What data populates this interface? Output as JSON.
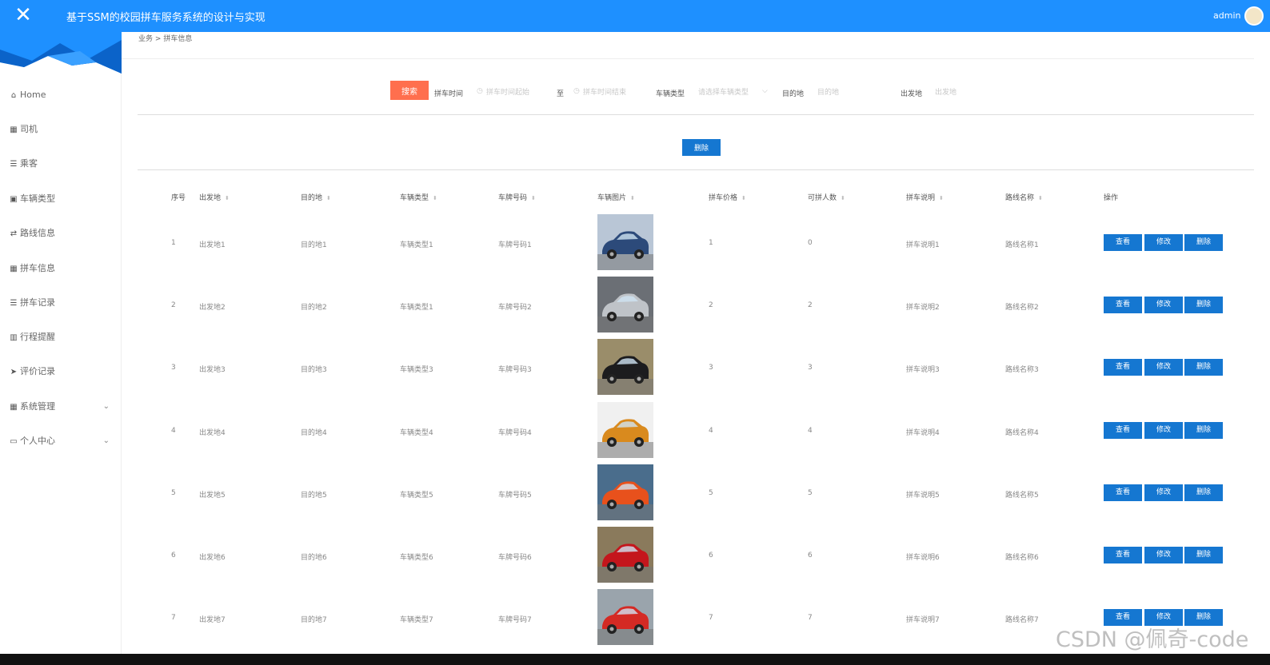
{
  "header": {
    "title": "基于SSM的校园拼车服务系统的设计与实现",
    "user": "admin",
    "brand_color": "#1e90ff"
  },
  "sidebar": {
    "items": [
      {
        "label": "Home",
        "icon": "home-icon"
      },
      {
        "label": "司机",
        "icon": "grid-icon"
      },
      {
        "label": "乘客",
        "icon": "list-icon"
      },
      {
        "label": "车辆类型",
        "icon": "file-icon"
      },
      {
        "label": "路线信息",
        "icon": "route-icon"
      },
      {
        "label": "拼车信息",
        "icon": "grid-icon"
      },
      {
        "label": "拼车记录",
        "icon": "list-icon"
      },
      {
        "label": "行程提醒",
        "icon": "chart-icon"
      },
      {
        "label": "评价记录",
        "icon": "send-icon"
      },
      {
        "label": "系统管理",
        "icon": "grid-icon",
        "expandable": true
      },
      {
        "label": "个人中心",
        "icon": "card-icon",
        "expandable": true
      }
    ]
  },
  "breadcrumb": {
    "root": "业务",
    "sep": ">",
    "current": "拼车信息"
  },
  "search": {
    "button": "搜索",
    "time_label": "拼车时间",
    "time_start_placeholder": "拼车时间起始",
    "to_label": "至",
    "time_end_placeholder": "拼车时间结束",
    "type_label": "车辆类型",
    "type_placeholder": "请选择车辆类型",
    "dest_label": "目的地",
    "dest_placeholder": "目的地",
    "origin_label": "出发地",
    "origin_placeholder": "出发地",
    "accent_color": "#ff6f4e"
  },
  "actions": {
    "bulk_delete": "删除"
  },
  "table": {
    "headers": [
      "序号",
      "出发地",
      "目的地",
      "车辆类型",
      "车牌号码",
      "车辆图片",
      "拼车价格",
      "可拼人数",
      "拼车说明",
      "路线名称",
      "操作"
    ],
    "row_actions": {
      "view": "查看",
      "edit": "修改",
      "delete": "删除"
    },
    "rows": [
      {
        "no": "1",
        "origin": "出发地1",
        "dest": "目的地1",
        "type": "车辆类型1",
        "plate": "车牌号码1",
        "price": "1",
        "seats": "0",
        "desc": "拼车说明1",
        "route": "路线名称1",
        "car_color": "#2c4a7a",
        "bg": "#b9c6d6"
      },
      {
        "no": "2",
        "origin": "出发地2",
        "dest": "目的地2",
        "type": "车辆类型1",
        "plate": "车牌号码2",
        "price": "2",
        "seats": "2",
        "desc": "拼车说明2",
        "route": "路线名称2",
        "car_color": "#bfc3c8",
        "bg": "#6b6f75"
      },
      {
        "no": "3",
        "origin": "出发地3",
        "dest": "目的地3",
        "type": "车辆类型3",
        "plate": "车牌号码3",
        "price": "3",
        "seats": "3",
        "desc": "拼车说明3",
        "route": "路线名称3",
        "car_color": "#1c1c1e",
        "bg": "#9a8d6a"
      },
      {
        "no": "4",
        "origin": "出发地4",
        "dest": "目的地4",
        "type": "车辆类型4",
        "plate": "车牌号码4",
        "price": "4",
        "seats": "4",
        "desc": "拼车说明4",
        "route": "路线名称4",
        "car_color": "#d98a1e",
        "bg": "#f0f0f0"
      },
      {
        "no": "5",
        "origin": "出发地5",
        "dest": "目的地5",
        "type": "车辆类型5",
        "plate": "车牌号码5",
        "price": "5",
        "seats": "5",
        "desc": "拼车说明5",
        "route": "路线名称5",
        "car_color": "#e8511c",
        "bg": "#4a6d8c"
      },
      {
        "no": "6",
        "origin": "出发地6",
        "dest": "目的地6",
        "type": "车辆类型6",
        "plate": "车牌号码6",
        "price": "6",
        "seats": "6",
        "desc": "拼车说明6",
        "route": "路线名称6",
        "car_color": "#c4161c",
        "bg": "#8a7a5c"
      },
      {
        "no": "7",
        "origin": "出发地7",
        "dest": "目的地7",
        "type": "车辆类型7",
        "plate": "车牌号码7",
        "price": "7",
        "seats": "7",
        "desc": "拼车说明7",
        "route": "路线名称7",
        "car_color": "#d42a24",
        "bg": "#9aa4ac"
      }
    ]
  },
  "watermark": "CSDN @佩奇-code"
}
